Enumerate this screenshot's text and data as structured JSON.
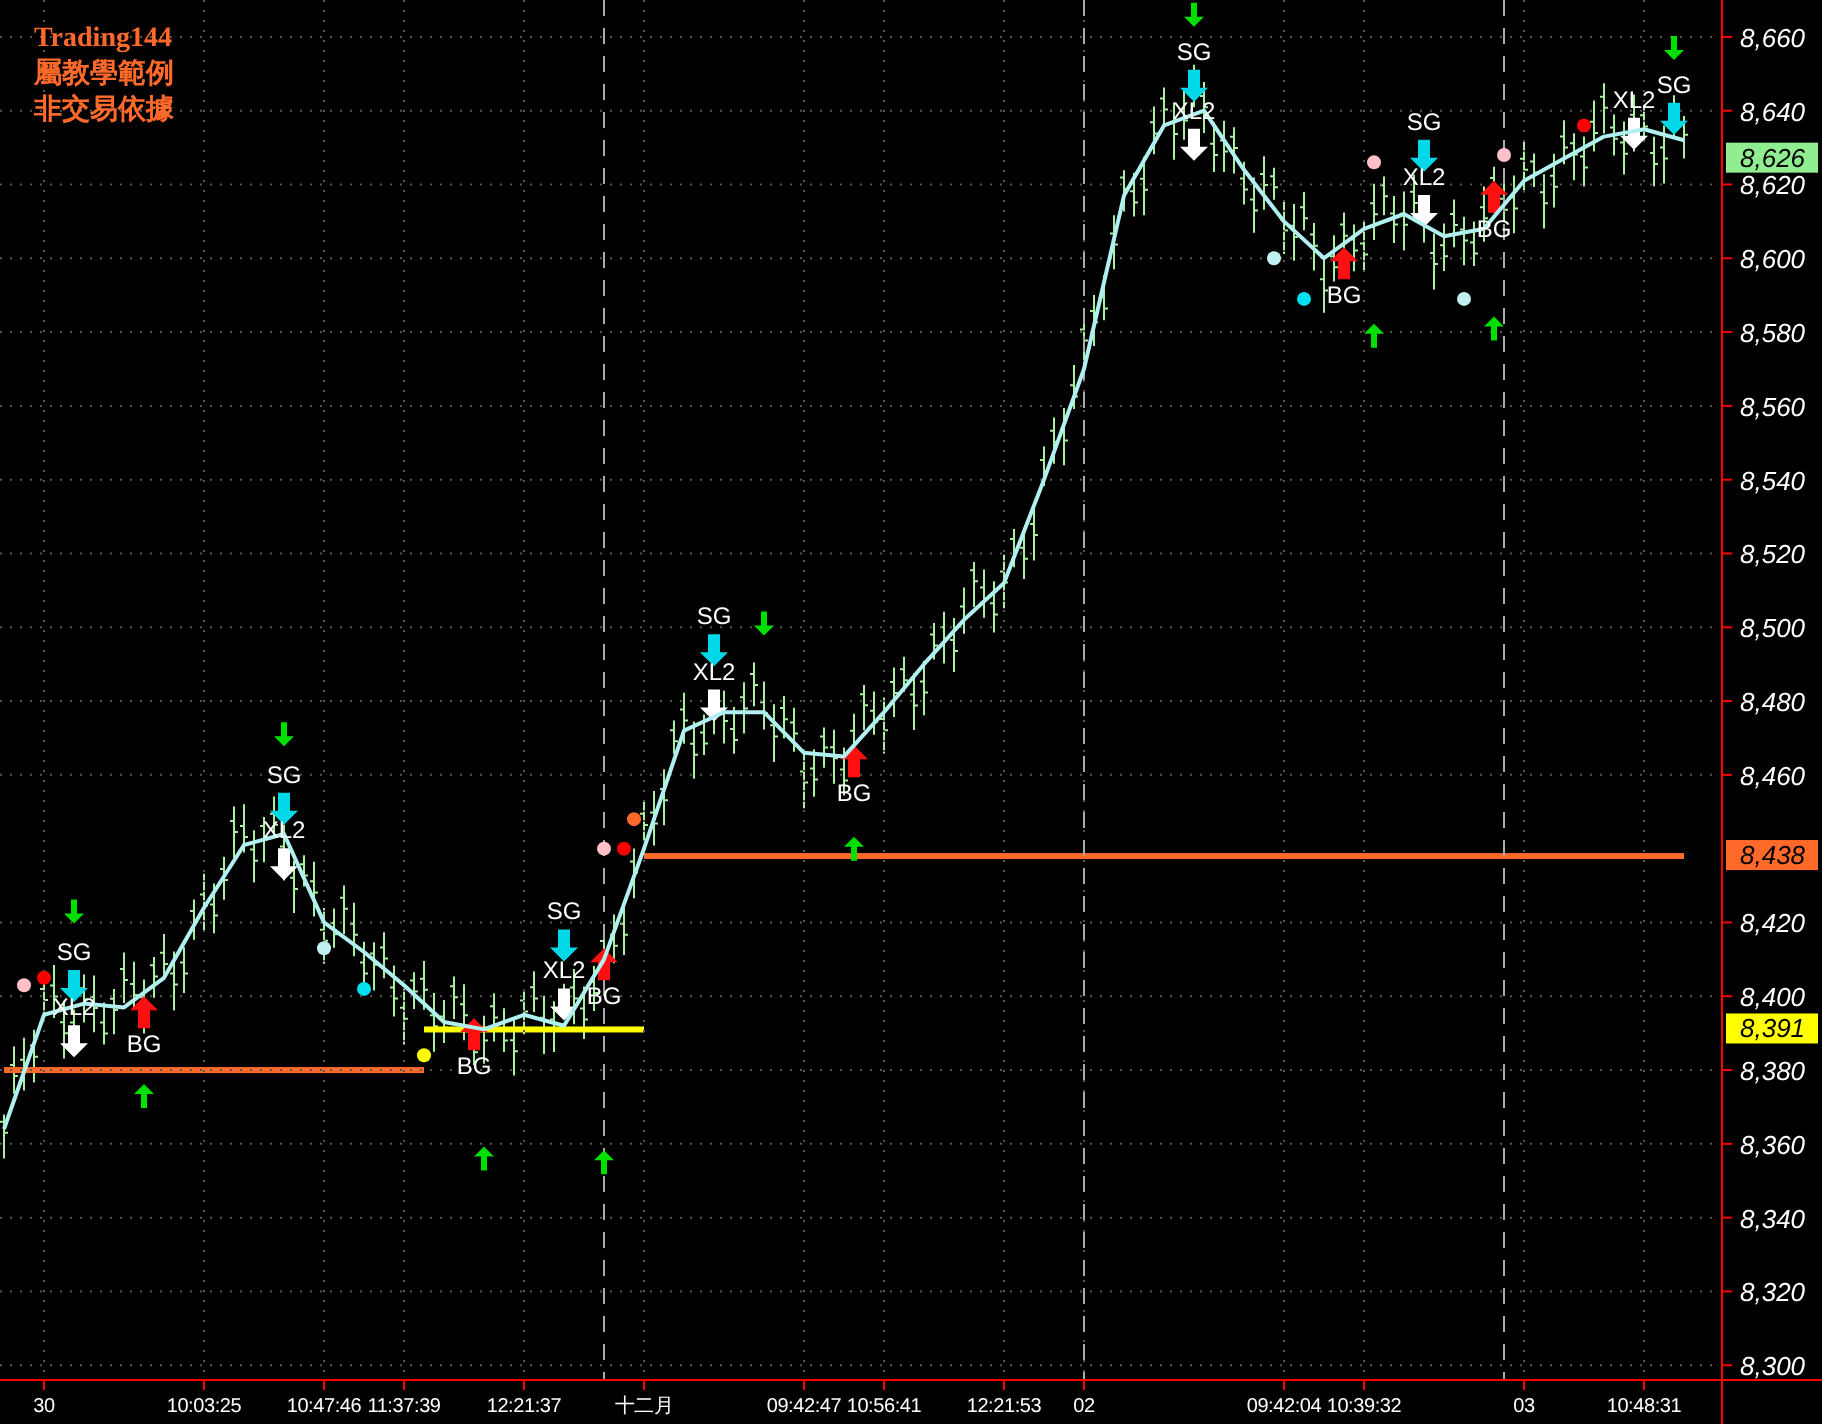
{
  "notes": [
    "Trading144",
    "屬教學範例",
    "非交易依據"
  ],
  "chart_data": {
    "type": "line",
    "ylim": [
      8296,
      8670
    ],
    "yticks": [
      {
        "value": 8660,
        "label": "8,660"
      },
      {
        "value": 8640,
        "label": "8,640"
      },
      {
        "value": 8620,
        "label": "8,620"
      },
      {
        "value": 8600,
        "label": "8,600"
      },
      {
        "value": 8580,
        "label": "8,580"
      },
      {
        "value": 8560,
        "label": "8,560"
      },
      {
        "value": 8540,
        "label": "8,540"
      },
      {
        "value": 8520,
        "label": "8,520"
      },
      {
        "value": 8500,
        "label": "8,500"
      },
      {
        "value": 8480,
        "label": "8,480"
      },
      {
        "value": 8460,
        "label": "8,460"
      },
      {
        "value": 8420,
        "label": "8,420"
      },
      {
        "value": 8400,
        "label": "8,400"
      },
      {
        "value": 8380,
        "label": "8,380"
      },
      {
        "value": 8360,
        "label": "8,360"
      },
      {
        "value": 8340,
        "label": "8,340"
      },
      {
        "value": 8320,
        "label": "8,320"
      },
      {
        "value": 8300,
        "label": "8,300"
      }
    ],
    "categories": [
      null,
      "30",
      null,
      null,
      null,
      "10:03:25",
      null,
      null,
      "10:47:46",
      null,
      "11:37:39",
      null,
      null,
      "12:21:37",
      null,
      null,
      "十二月",
      null,
      null,
      null,
      "09:42:47",
      null,
      "10:56:41",
      null,
      null,
      "12:21:53",
      null,
      "02",
      null,
      null,
      null,
      null,
      "09:42:04",
      null,
      "10:39:32",
      null,
      null,
      null,
      "03",
      null,
      null,
      "10:48:31",
      null
    ],
    "grid": true,
    "series": [
      {
        "color": "#b0f0f0",
        "values": [
          8364,
          8395,
          8398,
          8397,
          8405,
          8424,
          8441,
          8444,
          8420,
          8412,
          8403,
          8393,
          8391,
          8395,
          8392,
          8410,
          8440,
          8472,
          8477,
          8477,
          8466,
          8465,
          8477,
          8490,
          8502,
          8512,
          8540,
          8570,
          8617,
          8636,
          8640,
          8624,
          8610,
          8600,
          8608,
          8612,
          8606,
          8608,
          8621,
          8627,
          8633,
          8635,
          8632
        ]
      }
    ]
  },
  "signals": [
    {
      "kind": "sell",
      "text": "SG"
    },
    {
      "kind": "sell",
      "text": "SG"
    },
    {
      "kind": "sell",
      "text": "SG"
    },
    {
      "kind": "sell",
      "text": "SG"
    },
    {
      "kind": "sell",
      "text": "SG"
    },
    {
      "kind": "sell",
      "text": "SG"
    },
    {
      "kind": "sell",
      "text": "SG"
    },
    {
      "kind": "exit",
      "text": "XL2"
    },
    {
      "kind": "exit",
      "text": "XL2"
    },
    {
      "kind": "exit",
      "text": "XL2"
    },
    {
      "kind": "exit",
      "text": "XL2"
    },
    {
      "kind": "exit",
      "text": "XL2"
    },
    {
      "kind": "exit",
      "text": "XL2"
    },
    {
      "kind": "exit",
      "text": "XL2"
    },
    {
      "kind": "buy",
      "text": "BG"
    },
    {
      "kind": "buy",
      "text": "BG"
    },
    {
      "kind": "buy",
      "text": "BG"
    },
    {
      "kind": "buy",
      "text": "BG"
    },
    {
      "kind": "buy",
      "text": "BG"
    },
    {
      "kind": "buy",
      "text": "BG"
    }
  ],
  "arrows": [
    {
      "kind": "down"
    },
    {
      "kind": "down"
    },
    {
      "kind": "down"
    },
    {
      "kind": "down"
    },
    {
      "kind": "down"
    },
    {
      "kind": "up"
    },
    {
      "kind": "up"
    },
    {
      "kind": "up"
    },
    {
      "kind": "up"
    },
    {
      "kind": "up"
    },
    {
      "kind": "up"
    }
  ],
  "dots": [
    {
      "color": "#ffc0c8"
    },
    {
      "color": "#ffc0c8"
    },
    {
      "color": "#ffc0c8"
    },
    {
      "color": "#ffc0c8"
    },
    {
      "color": "#ff0000"
    },
    {
      "color": "#ff0000"
    },
    {
      "color": "#ff0000"
    },
    {
      "color": "#ff6a2a"
    },
    {
      "color": "#00e0f0"
    },
    {
      "color": "#00e0f0"
    },
    {
      "color": "#c0f0f0"
    },
    {
      "color": "#c0f0f0"
    },
    {
      "color": "#c0f0f0"
    },
    {
      "color": "#ffff00"
    }
  ],
  "level_lines": [
    {
      "color": "#ff6a2a"
    },
    {
      "color": "#ffff00"
    },
    {
      "color": "#ff6a2a"
    }
  ],
  "price_tags": [
    {
      "label": "8,626",
      "color": "#90ee90"
    },
    {
      "label": "8,438",
      "color": "#ff6a2a"
    },
    {
      "label": "8,391",
      "color": "#ffff00"
    }
  ]
}
